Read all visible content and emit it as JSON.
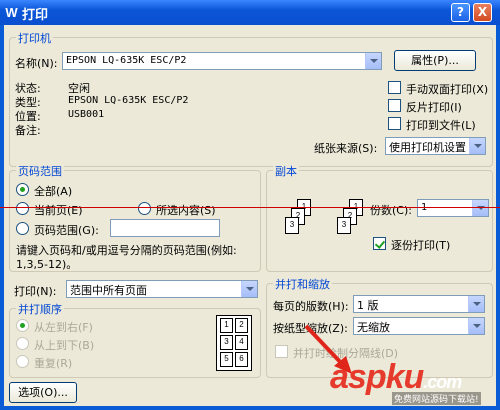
{
  "window": {
    "title": "打印",
    "icon": "W",
    "help": "?",
    "close": "X"
  },
  "printer": {
    "group_title": "打印机",
    "name_label": "名称(N):",
    "name_value": "EPSON LQ-635K ESC/P2",
    "properties_button": "属性(P)...",
    "status_label": "状态:",
    "status_value": "空闲",
    "type_label": "类型:",
    "type_value": "EPSON LQ-635K ESC/P2",
    "location_label": "位置:",
    "location_value": "USB001",
    "comment_label": "备注:",
    "duplex_label": "手动双面打印(X)",
    "duplex_checked": false,
    "mirror_label": "反片打印(I)",
    "mirror_checked": false,
    "tofile_label": "打印到文件(L)",
    "tofile_checked": false,
    "paper_source_label": "纸张来源(S):",
    "paper_source_value": "使用打印机设置"
  },
  "page_range": {
    "group_title": "页码范围",
    "all_label": "全部(A)",
    "current_label": "当前页(E)",
    "selection_label": "所选内容(S)",
    "pages_label": "页码范围(G):",
    "pages_value": "",
    "hint": "请键入页码和/或用逗号分隔的页码范围(例如:",
    "hint_example": "1,3,5-12)。",
    "selected": "all"
  },
  "copies": {
    "group_title": "副本",
    "count_label": "份数(C):",
    "count_value": "1",
    "collate_label": "逐份打印(T)",
    "collate_checked": true,
    "page_labels": [
      "1",
      "2",
      "3",
      "1",
      "2",
      "3"
    ]
  },
  "print_what": {
    "label": "打印(N):",
    "value": "范围中所有页面"
  },
  "order": {
    "group_title": "并打顺序",
    "left_right": "从左到右(F)",
    "top_bottom": "从上到下(B)",
    "repeat": "重复(R)",
    "page_labels": [
      "1",
      "2",
      "3",
      "4",
      "5",
      "6"
    ]
  },
  "zoom": {
    "group_title": "并打和缩放",
    "pages_per_sheet_label": "每页的版数(H):",
    "pages_per_sheet_value": "1 版",
    "scale_label": "按纸型缩放(Z):",
    "scale_value": "无缩放",
    "draw_borders_label": "并打时绘制分隔线(D)",
    "draw_borders_checked": false
  },
  "options_button": "选项(O)...",
  "watermark": {
    "text": "aspku",
    "suffix": ".com",
    "sub": "免费网站源码下载站!"
  },
  "colors": {
    "title_bar": "#0a5bd6",
    "group_title": "#0046d5",
    "dialog_bg": "#ece9d8",
    "annotation_red": "#d10000"
  }
}
